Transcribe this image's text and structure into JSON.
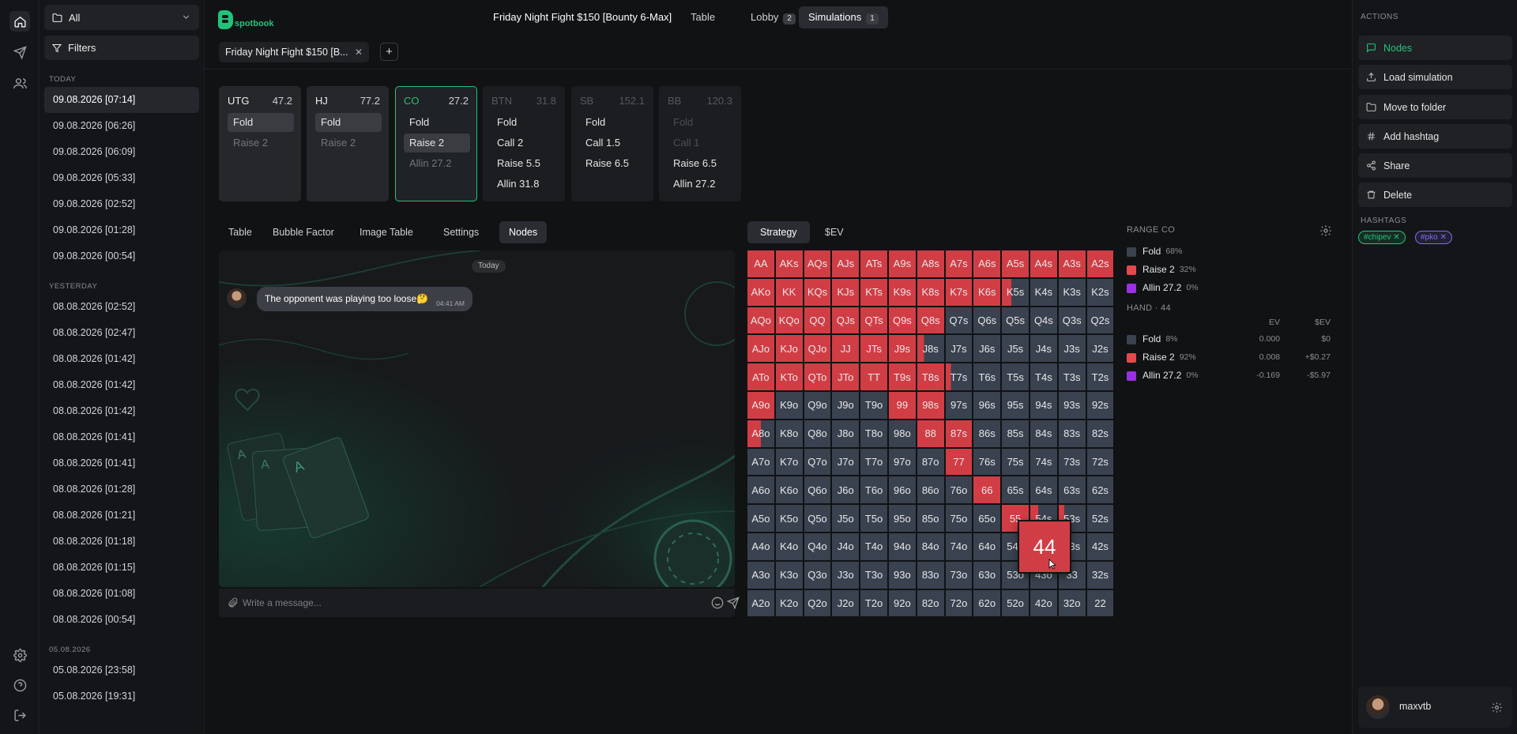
{
  "history": {
    "filter_value": "All",
    "filters_label": "Filters",
    "groups": [
      {
        "label": "TODAY",
        "items": [
          "09.08.2026 [07:14]",
          "09.08.2026 [06:26]",
          "09.08.2026 [06:09]",
          "09.08.2026 [05:33]",
          "09.08.2026 [02:52]",
          "09.08.2026 [01:28]",
          "09.08.2026 [00:54]"
        ]
      },
      {
        "label": "YESTERDAY",
        "items": [
          "08.08.2026 [02:52]",
          "08.08.2026 [02:47]",
          "08.08.2026 [01:42]",
          "08.08.2026 [01:42]",
          "08.08.2026 [01:42]",
          "08.08.2026 [01:41]",
          "08.08.2026 [01:41]",
          "08.08.2026 [01:28]",
          "08.08.2026 [01:21]",
          "08.08.2026 [01:18]",
          "08.08.2026 [01:15]",
          "08.08.2026 [01:08]",
          "08.08.2026 [00:54]"
        ]
      },
      {
        "label": "05.08.2026",
        "items": [
          "05.08.2026 [23:58]",
          "05.08.2026 [19:31]"
        ]
      }
    ]
  },
  "header": {
    "logo_text": "spotbook",
    "title": "Friday Night Fight $150 [Bounty 6-Max]",
    "tabs": [
      {
        "label": "Table",
        "badge": ""
      },
      {
        "label": "Lobby",
        "badge": "2"
      },
      {
        "label": "Simulations",
        "badge": "1"
      }
    ],
    "open_tab": "Friday Night Fight $150 [B...",
    "add_label": "+"
  },
  "seats": [
    {
      "name": "UTG",
      "stack": "47.2",
      "actions": [
        "Fold",
        "Raise 2"
      ]
    },
    {
      "name": "HJ",
      "stack": "77.2",
      "actions": [
        "Fold",
        "Raise 2"
      ]
    },
    {
      "name": "CO",
      "stack": "27.2",
      "actions": [
        "Fold",
        "Raise 2",
        "Allin 27.2"
      ]
    },
    {
      "name": "BTN",
      "stack": "31.8",
      "actions": [
        "Fold",
        "Call 2",
        "Raise 5.5",
        "Allin 31.8"
      ]
    },
    {
      "name": "SB",
      "stack": "152.1",
      "actions": [
        "Fold",
        "Call 1.5",
        "Raise 6.5"
      ]
    },
    {
      "name": "BB",
      "stack": "120.3",
      "actions": [
        "Fold",
        "Call 1",
        "Raise 6.5",
        "Allin 27.2"
      ]
    }
  ],
  "subtabs": [
    "Table",
    "Bubble Factor",
    "Image Table",
    "Settings",
    "Nodes"
  ],
  "chat": {
    "day_label": "Today",
    "message": "The opponent was playing too loose🤔",
    "time": "04:41 AM",
    "placeholder": "Write a message..."
  },
  "strategy_tabs": [
    "Strategy",
    "$EV"
  ],
  "grid": {
    "hands": [
      "AA",
      "AKs",
      "AQs",
      "AJs",
      "ATs",
      "A9s",
      "A8s",
      "A7s",
      "A6s",
      "A5s",
      "A4s",
      "A3s",
      "A2s",
      "AKo",
      "KK",
      "KQs",
      "KJs",
      "KTs",
      "K9s",
      "K8s",
      "K7s",
      "K6s",
      "K5s",
      "K4s",
      "K3s",
      "K2s",
      "AQo",
      "KQo",
      "QQ",
      "QJs",
      "QTs",
      "Q9s",
      "Q8s",
      "Q7s",
      "Q6s",
      "Q5s",
      "Q4s",
      "Q3s",
      "Q2s",
      "AJo",
      "KJo",
      "QJo",
      "JJ",
      "JTs",
      "J9s",
      "J8s",
      "J7s",
      "J6s",
      "J5s",
      "J4s",
      "J3s",
      "J2s",
      "ATo",
      "KTo",
      "QTo",
      "JTo",
      "TT",
      "T9s",
      "T8s",
      "T7s",
      "T6s",
      "T5s",
      "T4s",
      "T3s",
      "T2s",
      "A9o",
      "K9o",
      "Q9o",
      "J9o",
      "T9o",
      "99",
      "98s",
      "97s",
      "96s",
      "95s",
      "94s",
      "93s",
      "92s",
      "A8o",
      "K8o",
      "Q8o",
      "J8o",
      "T8o",
      "98o",
      "88",
      "87s",
      "86s",
      "85s",
      "84s",
      "83s",
      "82s",
      "A7o",
      "K7o",
      "Q7o",
      "J7o",
      "T7o",
      "97o",
      "87o",
      "77",
      "76s",
      "75s",
      "74s",
      "73s",
      "72s",
      "A6o",
      "K6o",
      "Q6o",
      "J6o",
      "T6o",
      "96o",
      "86o",
      "76o",
      "66",
      "65s",
      "64s",
      "63s",
      "62s",
      "A5o",
      "K5o",
      "Q5o",
      "J5o",
      "T5o",
      "95o",
      "85o",
      "75o",
      "65o",
      "55",
      "54s",
      "53s",
      "52s",
      "A4o",
      "K4o",
      "Q4o",
      "J4o",
      "T4o",
      "94o",
      "84o",
      "74o",
      "64o",
      "54o",
      "44",
      "43s",
      "42s",
      "A3o",
      "K3o",
      "Q3o",
      "J3o",
      "T3o",
      "93o",
      "83o",
      "73o",
      "63o",
      "53o",
      "43o",
      "33",
      "32s",
      "A2o",
      "K2o",
      "Q2o",
      "J2o",
      "T2o",
      "92o",
      "82o",
      "72o",
      "62o",
      "52o",
      "42o",
      "32o",
      "22"
    ],
    "raise": [
      "AA",
      "AKs",
      "AQs",
      "AJs",
      "ATs",
      "A9s",
      "A8s",
      "A7s",
      "A6s",
      "A5s",
      "A4s",
      "A3s",
      "A2s",
      "AKo",
      "KK",
      "KQs",
      "KJs",
      "KTs",
      "K9s",
      "K8s",
      "K7s",
      "K6s",
      "K5s",
      "AQo",
      "KQo",
      "QQ",
      "QJs",
      "QTs",
      "Q9s",
      "Q8s",
      "AJo",
      "KJo",
      "QJo",
      "JJ",
      "JTs",
      "J9s",
      "J8s",
      "ATo",
      "KTo",
      "QTo",
      "JTo",
      "TT",
      "T9s",
      "T8s",
      "A9o",
      "99",
      "98s",
      "A8o",
      "88",
      "87s",
      "77",
      "66",
      "55",
      "44"
    ],
    "popup_hand": "44"
  },
  "range": {
    "title": "RANGE CO",
    "legend": [
      {
        "label": "Fold",
        "pct": "68%",
        "color": "#3a4250"
      },
      {
        "label": "Raise 2",
        "pct": "32%",
        "color": "#e5484d"
      },
      {
        "label": "Allin 27.2",
        "pct": "0%",
        "color": "#9b30e0"
      }
    ],
    "hand_title": "HAND · 44",
    "ev_header": "EV",
    "sev_header": "$EV",
    "hand_rows": [
      {
        "label": "Fold",
        "pct": "8%",
        "ev": "0.000",
        "sev": "$0",
        "color": "#3a4250"
      },
      {
        "label": "Raise 2",
        "pct": "92%",
        "ev": "0.008",
        "sev": "+$0.27",
        "color": "#e5484d"
      },
      {
        "label": "Allin 27.2",
        "pct": "0%",
        "ev": "-0.169",
        "sev": "-$5.97",
        "color": "#9b30e0"
      }
    ]
  },
  "actions": {
    "title": "ACTIONS",
    "items": [
      "Nodes",
      "Load simulation",
      "Move to folder",
      "Add hashtag",
      "Share",
      "Delete"
    ],
    "hashtags_title": "HASHTAGS",
    "hashtags": [
      {
        "label": "#chipev",
        "color": "#22c37a"
      },
      {
        "label": "#pko",
        "color": "#7b6cf0"
      }
    ]
  },
  "user": {
    "name": "maxvtb"
  },
  "colors": {
    "accent": "#22c37a",
    "raise": "#d13d45",
    "fold": "#3a4250"
  }
}
